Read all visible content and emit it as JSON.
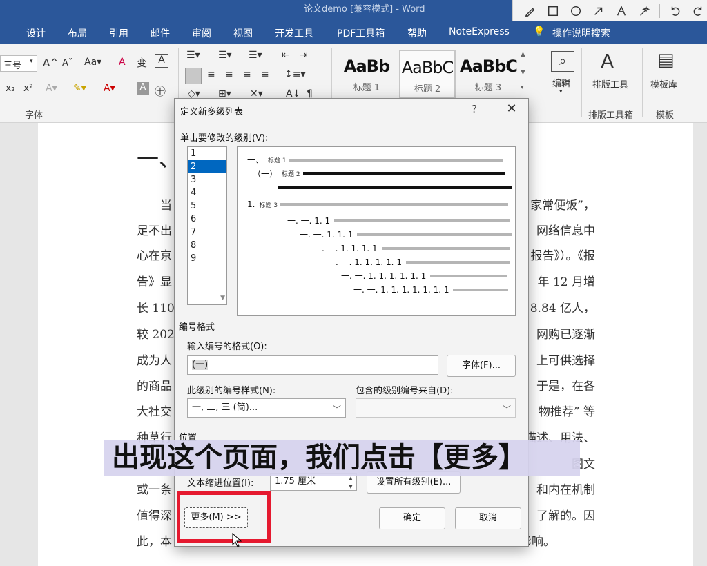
{
  "window": {
    "title": "论文demo [兼容模式] - Word"
  },
  "tabs": [
    "设计",
    "布局",
    "引用",
    "邮件",
    "审阅",
    "视图",
    "开发工具",
    "PDF工具箱",
    "帮助",
    "NoteExpress",
    "操作说明搜索"
  ],
  "ribbon": {
    "font_size": "三号",
    "font_group": "字体",
    "styles": [
      {
        "sample": "AaBb",
        "name": "标题 1"
      },
      {
        "sample": "AaBbC",
        "name": "标题 2"
      },
      {
        "sample": "AaBbC",
        "name": "标题 3"
      }
    ],
    "edit_label": "编辑",
    "layout_tool": "排版工具",
    "layout_group": "排版工具箱",
    "template_lib": "模板库",
    "template_group": "模板"
  },
  "document": {
    "heading": "一、",
    "lines_left": [
      "当",
      "足不出",
      "心在京",
      "告》显",
      "长 110",
      "较 202",
      "成为人",
      "的商品",
      "大社交",
      "种草行",
      "",
      "或一条",
      "值得深",
      "此，本"
    ],
    "lines_right": [
      "家常便饭”，",
      "网络信息中",
      "报告》）。《报",
      "年 12 月增",
      "8.84 亿人，",
      "网购已逐渐",
      "上可供选择",
      "于是，在各",
      "物推荐” 等",
      "描述、用法、",
      "图文",
      "和内在机制",
      "了解的。因",
      "对消费者购买决策的影响。"
    ]
  },
  "dialog": {
    "title": "定义新多级列表",
    "help": "?",
    "close": "✕",
    "level_prompt": "单击要修改的级别(V):",
    "levels": [
      "1",
      "2",
      "3",
      "4",
      "5",
      "6",
      "7",
      "8",
      "9"
    ],
    "selected_level": "2",
    "preview": [
      {
        "num": "一、",
        "tag": "标题 1"
      },
      {
        "num": "（一）",
        "tag": "标题 2"
      },
      {
        "num": "",
        "tag": ""
      },
      {
        "num": "1.",
        "tag": "标题 3"
      },
      {
        "num": "一. 一. 1. 1",
        "tag": ""
      },
      {
        "num": "一. 一. 1. 1. 1",
        "tag": ""
      },
      {
        "num": "一. 一. 1. 1. 1. 1",
        "tag": ""
      },
      {
        "num": "一. 一. 1. 1. 1. 1. 1",
        "tag": ""
      },
      {
        "num": "一. 一. 1. 1. 1. 1. 1. 1",
        "tag": ""
      },
      {
        "num": "一. 一. 1. 1. 1. 1. 1. 1. 1",
        "tag": ""
      }
    ],
    "number_format_section": "编号格式",
    "enter_format_label": "输入编号的格式(O):",
    "format_value": "(一)",
    "font_button": "字体(F)...",
    "number_style_label": "此级别的编号样式(N):",
    "number_style_value": "一, 二, 三 (简)...",
    "include_level_label": "包含的级别编号来自(D):",
    "position_section": "位置",
    "text_indent_label": "文本缩进位置(I):",
    "text_indent_value": "1.75 厘米",
    "set_all_button": "设置所有级别(E)...",
    "more_button": "更多(M) >>",
    "ok_button": "确定",
    "cancel_button": "取消"
  },
  "subtitle": "出现这个页面，我们点击【更多】",
  "colors": {
    "word_blue": "#2b579a",
    "highlight_red": "#e5192f",
    "selection_blue": "#0067c0"
  }
}
